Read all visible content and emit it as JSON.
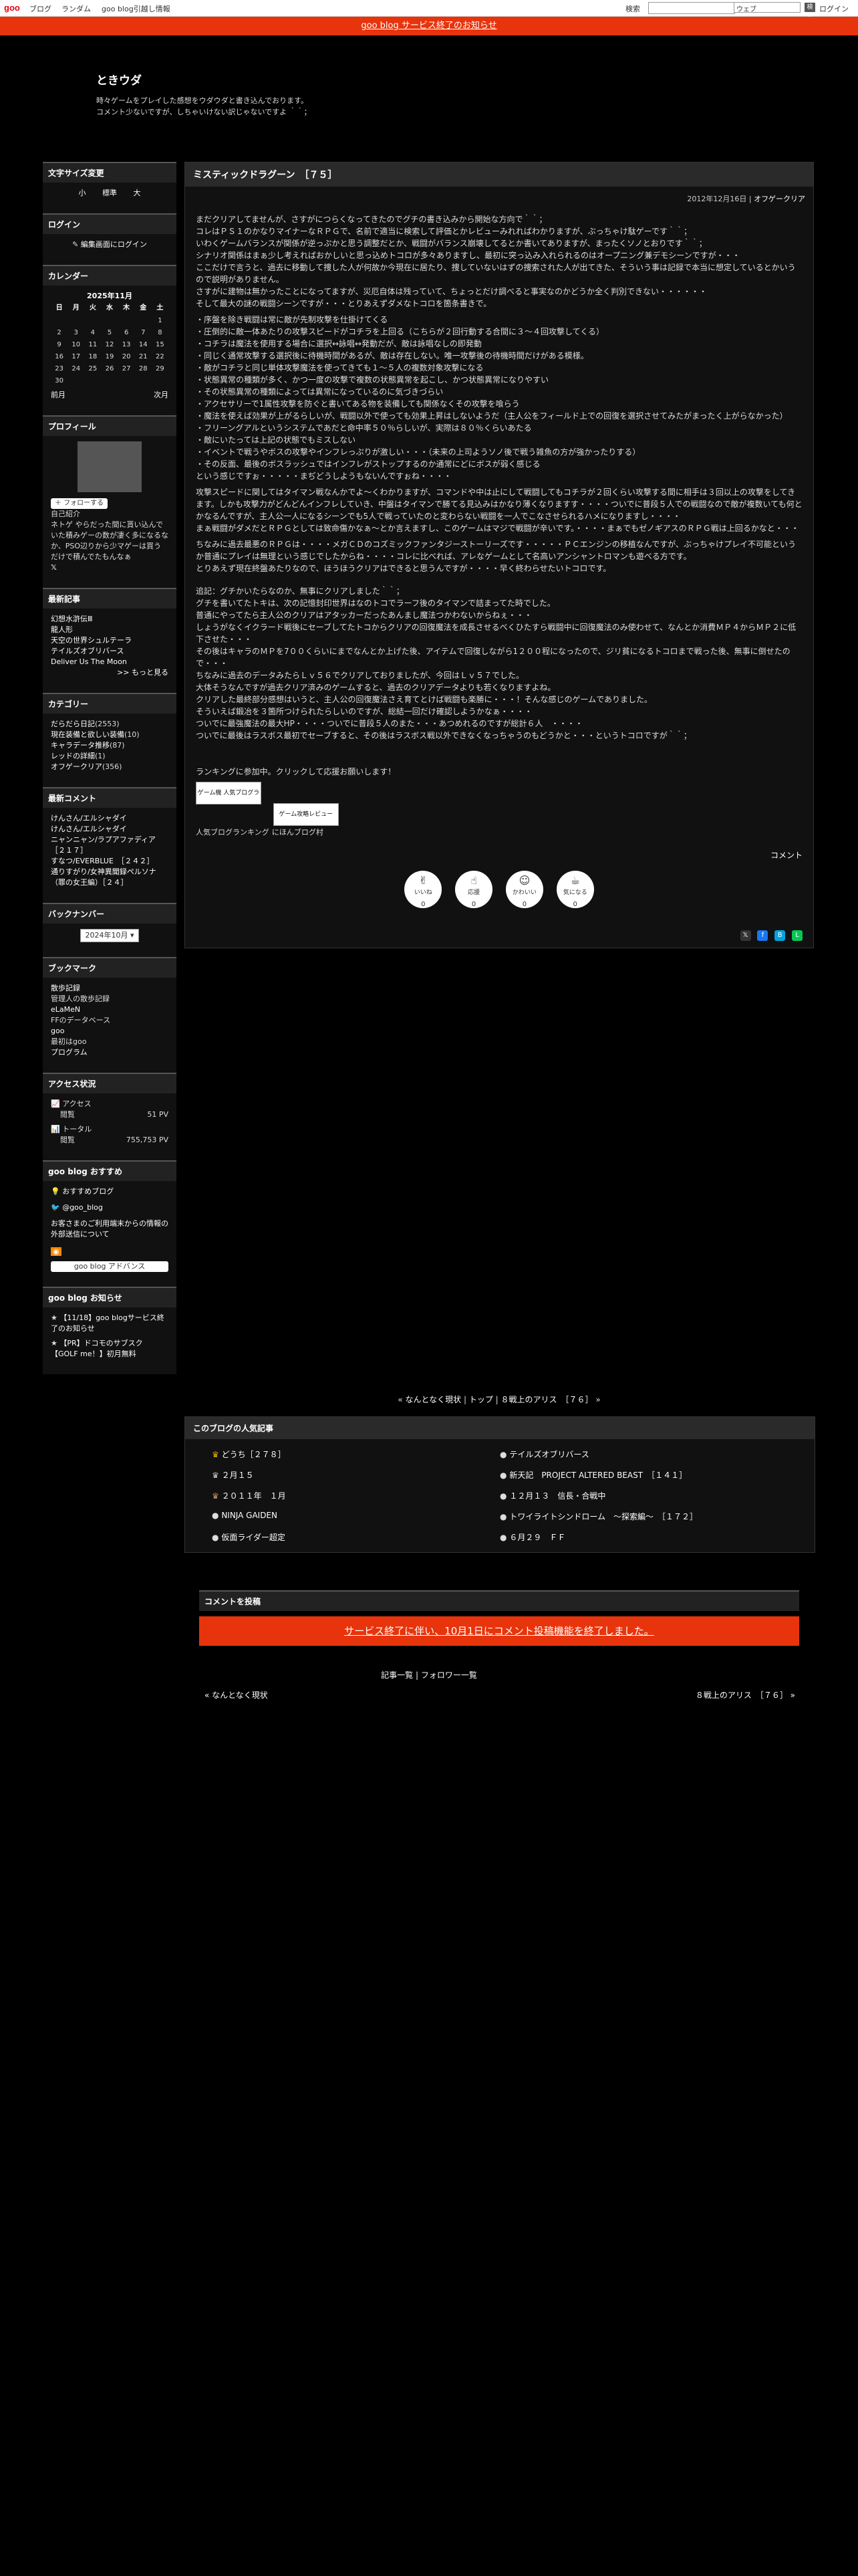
{
  "topbar": {
    "logo": "goo",
    "links": [
      "ブログ",
      "ランダム",
      "goo blog引越し情報"
    ],
    "search_label": "検索",
    "search_scope": "ウェブ",
    "search_btn": "検索",
    "login": "ログイン"
  },
  "notice": "goo blog サービス終了のお知らせ",
  "blog": {
    "title": "ときウダ",
    "desc_line1": "時々ゲームをプレイした感想をウダウダと書き込んでおります。",
    "desc_line2": "コメント少ないですが、しちゃいけない訳じゃないですよ ｀｀；"
  },
  "side": {
    "fontsize": {
      "head": "文字サイズ変更",
      "items": [
        "小",
        "標準",
        "大"
      ]
    },
    "login": {
      "head": "ログイン",
      "link": "編集画面にログイン"
    },
    "calendar": {
      "head": "カレンダー",
      "month": "2025年11月",
      "days": [
        "日",
        "月",
        "火",
        "水",
        "木",
        "金",
        "土"
      ],
      "rows": [
        [
          "",
          "",
          "",
          "",
          "",
          "",
          "1"
        ],
        [
          "2",
          "3",
          "4",
          "5",
          "6",
          "7",
          "8"
        ],
        [
          "9",
          "10",
          "11",
          "12",
          "13",
          "14",
          "15"
        ],
        [
          "16",
          "17",
          "18",
          "19",
          "20",
          "21",
          "22"
        ],
        [
          "23",
          "24",
          "25",
          "26",
          "27",
          "28",
          "29"
        ],
        [
          "30",
          "",
          "",
          "",
          "",
          "",
          ""
        ]
      ],
      "prev": "前月",
      "next": "次月"
    },
    "profile": {
      "head": "プロフィール",
      "follow": "フォローする",
      "name": "自己紹介",
      "text": "ネトゲ やらだった間に貰い込んでいた積みゲーの数が凄く多になるなか、PSO辺りから少マゲーは買うだけで積んでたもんなぁ"
    },
    "recent": {
      "head": "最新記事",
      "items": [
        "幻想水滸伝Ⅲ",
        "龍人形",
        "天空の世界シュルテーラ",
        "テイルズオブリバース",
        "Deliver Us The Moon"
      ],
      "more": ">> もっと見る"
    },
    "category": {
      "head": "カテゴリー",
      "items": [
        {
          "n": "だらだら日記",
          "c": "(2553)"
        },
        {
          "n": "現在装備と欲しい装備",
          "c": "(10)"
        },
        {
          "n": "キャラデータ推移",
          "c": "(87)"
        },
        {
          "n": "レッドの詳細",
          "c": "(1)"
        },
        {
          "n": "オフゲークリア",
          "c": "(356)"
        }
      ]
    },
    "comments": {
      "head": "最新コメント",
      "items": [
        "けんさん/エルシャダイ",
        "けんさん/エルシャダイ",
        "ニャンニャン/ラプアファディア　［２１７］",
        "すなつ/EVERBLUE　［２４２］",
        "通りすがり/女神異聞録ペルソナ（罪の女王編）［２４］"
      ]
    },
    "backnumber": {
      "head": "バックナンバー",
      "value": "2024年10月"
    },
    "bookmark": {
      "head": "ブックマーク",
      "items": [
        "散歩記録",
        "管理人の散歩記録",
        "eLaMeN",
        "FFのデータベース",
        "goo",
        "最初はgoo",
        "プログラム"
      ]
    },
    "access": {
      "head": "アクセス状況",
      "a_label": "アクセス",
      "a_sub": "閲覧",
      "a_val": "51 PV",
      "t_label": "トータル",
      "t_sub": "閲覧",
      "t_val": "755,753 PV"
    },
    "goo_rec": {
      "head": "goo blog おすすめ",
      "items": [
        "おすすめブログ",
        "@goo_blog",
        "お客さまのご利用端末からの情報の外部送信について"
      ],
      "adv": "goo blog アドバンス"
    },
    "goo_news": {
      "head": "goo blog お知らせ",
      "items": [
        "【11/18】goo blogサービス終了のお知らせ",
        "【PR】ドコモのサブスク【GOLF me！】初月無料"
      ]
    }
  },
  "post": {
    "title": "ミスティックドラグーン　［７５］",
    "date": "2012年12月16日",
    "category": "オフゲークリア",
    "paras": [
      "まだクリアしてませんが、さすがにつらくなってきたのでグチの書き込みから開始な方向で｀｀；\nコレはＰＳ１のかなりマイナーなＲＰＧで、名前で適当に検索して評価とかレビューみれればわかりますが、ぶっちゃけ駄ゲーです｀｀；\nいわくゲームバランスが関係が逆っぷかと思う調整だとか、戦闘がバランス崩壊してるとか書いてありますが、まったくソノとおりです｀｀；\nシナリオ関係はまぁ少し考えればおかしいと思っ込めトコロが多々ありますし、最初に突っ込み入れられるのはオープニング兼デモシーンですが・・・\nここだけで言うと、過去に移動して捜した人が何故か今現在に居たり、捜していないはずの捜索された人が出てきた、そういう事は記録で本当に想定しているとかいうので説明がありません。\nさすがに建物は無かったことになってますが、災厄自体は残っていて、ちょっとだけ調べると事実なのかどうか全く判別できない・・・・・・\nそして最大の謎の戦闘シーンですが・・・とりあえずダメなトコロを箇条書きで。",
      "・序盤を除き戦闘は常に敵が先制攻撃を仕掛けてくる\n・圧倒的に敵一体あたりの攻撃スピードがコチラを上回る（こちらが２回行動する合間に３〜４回攻撃してくる）\n・コチラは魔法を使用する場合に選択↔詠唱↔発動だが、敵は詠唱なしの即発動\n・同じく通常攻撃する選択後に待機時間があるが、敵は存在しない。唯一攻撃後の待機時間だけがある模様。\n・敵がコチラと同じ単体攻撃魔法を使ってきても１〜５人の複数対象攻撃になる\n・状態異常の種類が多く、かつ一度の攻撃で複数の状態異常を起こし、かつ状態異常になりやすい\n・その状態異常の種類によっては異常になっているのに気づきづらい\n・アクセサリーで1属性攻撃を防ぐと書いてある物を装備しても関係なくその攻撃を喰らう\n・魔法を使えば効果が上がるらしいが、戦闘以外で使っても効果上昇はしないようだ（主人公をフィールド上での回復を選択させてみたがまったく上がらなかった）\n・フリーングアルというシステムであだと命中率５０％らしいが、実際は８０％くらいあたる\n・敵にいたっては上記の状態でもミスしない\n・イベントで戦うやボスの攻撃やインフレっぷりが激しい・・・（未来の上司ようソノ後で戦う雑魚の方が強かったりする）\n・その反面、最後のボスラッシュではインフレがストップするのか通常にどにボスが弱く感じる\nという感じですぉ・・・・・まぢどうしようもないんですぉね・・・・"
    ],
    "para3": "攻撃スピードに関してはタイマン戦なんかでよ〜くわかりますが、コマンドや中は止にして戦闘してもコチラが２回くらい攻撃する間に相手は３回以上の攻撃をしてきます。しかも攻撃力がどんどんインフレしていき、中盤はタイマンで勝てる見込みはかなり薄くなりますす・・・・ついでに普段５人での戦闘なので敵が複数いても何とかなるんですが、主人公一人になるシーンでも5人で戦っていたのと変わらない戦闘を一人でこなさせられるハメになりますし・・・・\nまぁ戦闘がダメだとＲＰＧとしては致命傷かなぁ〜とか言えますし、このゲームはマジで戦闘が辛いです。・・・・まぁでもゼノギアスのＲＰＧ戦は上回るかなと・・・",
    "para4": "ちなみに過去最悪のＲＰＧは・・・・メガＣＤのコズミックファンタジーストーリーズです・・・・・ＰＣエンジンの移植なんですが、ぶっちゃけプレイ不可能というか普通にプレイは無理という感じでしたからね・・・・コレに比べれば、アレなゲームとして名高いアンシャントロマンも遊べる方です。\nとりあえず現在終盤あたりなので、ほうほうクリアはできると思うんですが・・・・早く終わらせたいトコロです。",
    "para5": "追記：グチかいたらなのか、無事にクリアしました｀｀；\nグチを書いてたトキは、次の記憶封印世界はなのトコでラーフ後のタイマンで詰まってた時でした。\n普通にやってたら主人公のクリアはアタッカーだったあんまし魔法つかわないからねぇ・・・\nしょうがなくイクラード戦後にセーブしてたトコからクリアの回復魔法を成長させるべくひたすら戦闘中に回復魔法のみ使わせて、なんとか消費ＭＰ４からＭＰ２に低下させた・・・\nその後はキャラのＭＰを7００くらいにまでなんとか上げた後、アイテムで回復しながら1２００程になったので、ジリ貧になるトコロまで戦った後、無事に倒せたので・・・\nちなみに過去のデータみたらＬｖ５６でクリアしておりましたが、今回はＬｖ５７でした。\n大体そうなんですが過去クリア済みのゲームすると、過去のクリアデータよりも若くなりますよね。\nクリアした最終部分感想はいうと、主人公の回復魔法さえ育てとけば戦闘も楽勝に・・・！そんな感じのゲームでありました。\nそういえば鍛冶を３箇所つけられたらしいのですが、総結一回だけ確認しようかなぁ・・・・\nついでに最強魔法の最大HP・・・・ついでに普段５人のまた・・・あつめれるのですが総計６人　・・・・\nついでに最後はラスボス最初でセーブすると、その後はラスボス戦以外できなくなっちゃうのもどうかと・・・というトコロですが｀｀；",
    "ranking": {
      "msg": "ランキングに参加中。クリックして応援お願いします！",
      "btn1": "ゲーム機 人気ブログランキング",
      "btn2": "ゲーム攻略レビュー",
      "lbl1": "人気ブログランキング",
      "lbl2": "にほんブログ村"
    },
    "comment_link": "コメント",
    "reactions": [
      {
        "t": "いいね",
        "e": "✌",
        "c": "0"
      },
      {
        "t": "応援",
        "e": "☝",
        "c": "0"
      },
      {
        "t": "かわいい",
        "e": "☺",
        "c": "0"
      },
      {
        "t": "気になる",
        "e": "☕",
        "c": "0"
      }
    ]
  },
  "pager": {
    "prev": "なんとなく現状",
    "top": "トップ",
    "next": "８戦上のアリス　［７６］"
  },
  "popular": {
    "head": "このブログの人気記事",
    "items": [
      "どうち［２７８］",
      "テイルズオブリバース",
      "２月１５",
      "新天記　PROJECT ALTERED BEAST　［１４１］",
      "２０１１年　１月",
      "１２月１３　信長・合戦中",
      "NINJA GAIDEN",
      "トワイライトシンドローム　〜探索編〜　［１７２］",
      "仮面ライダー超定",
      "６月２９　ＦＦ"
    ]
  },
  "comment": {
    "head": "コメントを投稿",
    "red": "サービス終了に伴い、10月1日にコメント投稿機能を終了しました。"
  },
  "footer": {
    "list": "記事一覧",
    "follower": "フォロワー一覧",
    "prev": "なんとなく現状",
    "next": "８戦上のアリス　［７６］"
  }
}
